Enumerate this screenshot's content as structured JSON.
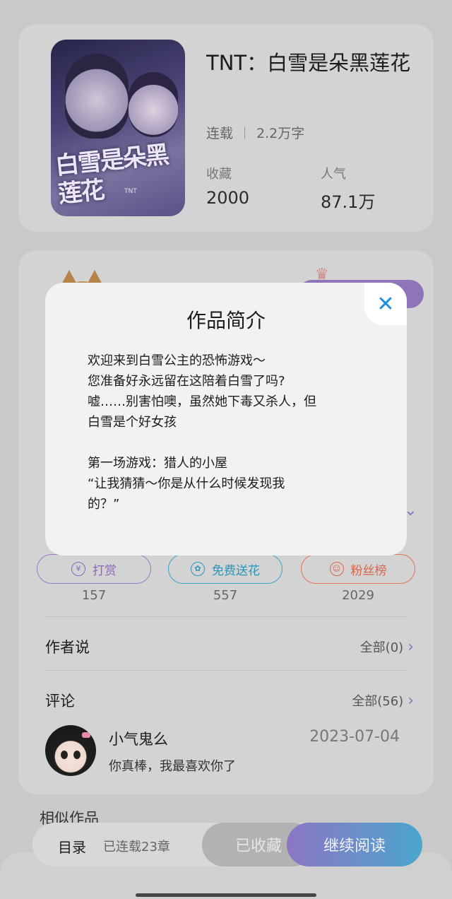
{
  "book": {
    "title": "TNT：白雪是朵黑莲花",
    "status": "连载",
    "word_count": "2.2万字",
    "favorites_label": "收藏",
    "favorites_value": "2000",
    "popularity_label": "人气",
    "popularity_value": "87.1万",
    "cover_text_main": "白雪是朵黑莲花",
    "cover_text_brand": "TNT"
  },
  "actions": [
    {
      "label": "打赏",
      "count": "157",
      "icon": "yen-icon",
      "color": "#8a66bc"
    },
    {
      "label": "免费送花",
      "count": "557",
      "icon": "flower-icon",
      "color": "#2a95bb"
    },
    {
      "label": "粉丝榜",
      "count": "2029",
      "icon": "user-icon",
      "color": "#d9654d"
    }
  ],
  "author_note": {
    "title": "作者说",
    "link": "全部(0)"
  },
  "comments": {
    "title": "评论",
    "link": "全部(56)",
    "items": [
      {
        "name": "小气鬼么",
        "date": "2023-07-04",
        "text": "你真棒，我最喜欢你了"
      }
    ]
  },
  "similar": {
    "title": "相似作品"
  },
  "bottom_bar": {
    "toc": "目录",
    "serial": "已连载23章",
    "collected": "已收藏",
    "continue": "继续阅读"
  },
  "modal": {
    "title": "作品简介",
    "close_icon": "close-icon",
    "lines": [
      "欢迎来到白雪公主的恐怖游戏～",
      "您准备好永远留在这陪着白雪了吗?",
      "嘘……别害怕噢，虽然她下毒又杀人，但",
      "白雪是个好女孩",
      "",
      "第一场游戏：猎人的小屋",
      "“让我猜猜～你是从什么时候发现我",
      "的？”"
    ]
  },
  "colors": {
    "accent_purple": "#8d75c4",
    "accent_blue": "#4aa6cf",
    "close_blue": "#1a8fe0"
  }
}
